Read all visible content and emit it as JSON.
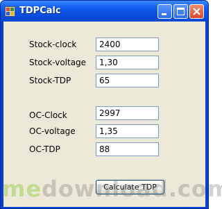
{
  "window": {
    "title": "TDPCalc",
    "accent": "#0a4fe0"
  },
  "stock": {
    "clock_label": "Stock-clock",
    "clock_value": "2400",
    "voltage_label": "Stock-voltage",
    "voltage_value": "1,30",
    "tdp_label": "Stock-TDP",
    "tdp_value": "65"
  },
  "oc": {
    "clock_label": "OC-Clock",
    "clock_value": "2997",
    "voltage_label": "OC-voltage",
    "voltage_value": "1,35",
    "tdp_label": "OC-TDP",
    "tdp_value": "88"
  },
  "actions": {
    "calculate_label": "Calculate TDP"
  },
  "watermark": {
    "prefix": "me",
    "suffix": "download.com"
  }
}
